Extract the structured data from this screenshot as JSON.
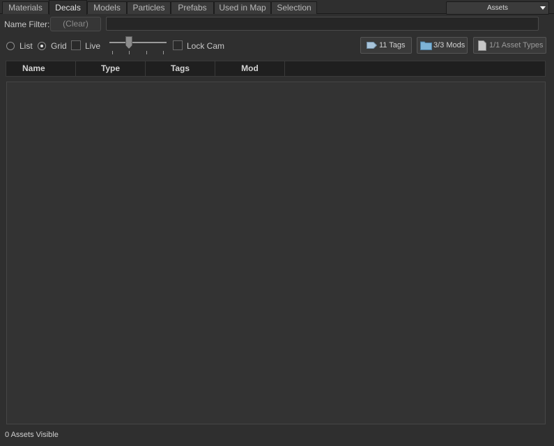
{
  "tabs": [
    {
      "label": "Materials",
      "active": false
    },
    {
      "label": "Decals",
      "active": true
    },
    {
      "label": "Models",
      "active": false
    },
    {
      "label": "Particles",
      "active": false
    },
    {
      "label": "Prefabs",
      "active": false
    },
    {
      "label": "Used in Map",
      "active": false
    },
    {
      "label": "Selection",
      "active": false
    }
  ],
  "assets_dropdown": {
    "label": "Assets"
  },
  "filter": {
    "label": "Name Filter:",
    "clear_label": "(Clear)",
    "value": ""
  },
  "view": {
    "list_label": "List",
    "grid_label": "Grid",
    "selected": "Grid",
    "live_label": "Live",
    "live_checked": false,
    "lock_cam_label": "Lock Cam",
    "lock_cam_checked": false
  },
  "buttons": {
    "tags_label": "11 Tags",
    "mods_label": "3/3 Mods",
    "types_label": "1/1 Asset Types"
  },
  "columns": [
    "Name",
    "Type",
    "Tags",
    "Mod"
  ],
  "status": {
    "text": "0 Assets Visible"
  },
  "icons": {
    "tag": "tag-icon",
    "folder": "folder-icon",
    "document": "document-icon",
    "sort": "sort-ascending-icon",
    "dropdown": "chevron-down-icon"
  },
  "colors": {
    "background": "#2f2f2f",
    "header": "#1f1f1f",
    "folder": "#7eb3d6"
  }
}
